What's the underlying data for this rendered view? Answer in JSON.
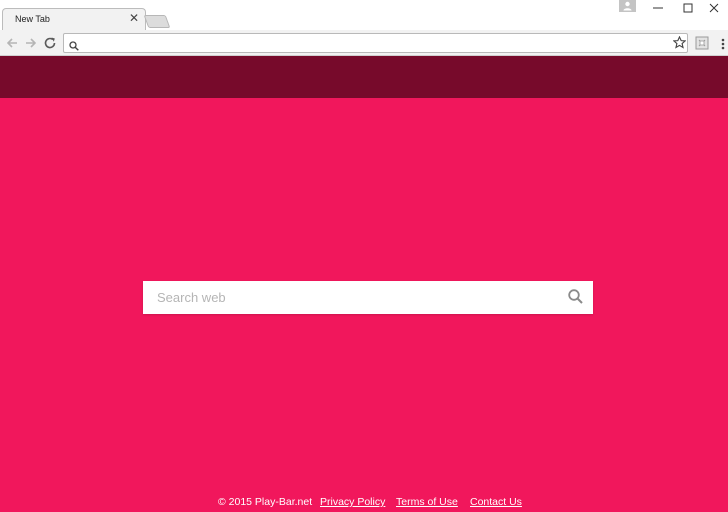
{
  "browser": {
    "tab_title": "New Tab",
    "tab_close_glyph": "✕",
    "address_value": "",
    "icons": [
      "back-icon",
      "forward-icon",
      "reload-icon",
      "search-icon",
      "star-icon",
      "extension-icon",
      "menu-icon",
      "profile-icon",
      "minimize-icon",
      "maximize-icon",
      "close-icon"
    ]
  },
  "page": {
    "colors": {
      "header": "#770a2b",
      "background": "#f1175c",
      "search_box": "#ffffff"
    },
    "search": {
      "placeholder": "Search web",
      "value": ""
    },
    "footer": {
      "copyright": "© 2015 Play-Bar.net",
      "links": [
        "Privacy Policy",
        "Terms of Use",
        "Contact Us"
      ]
    }
  }
}
